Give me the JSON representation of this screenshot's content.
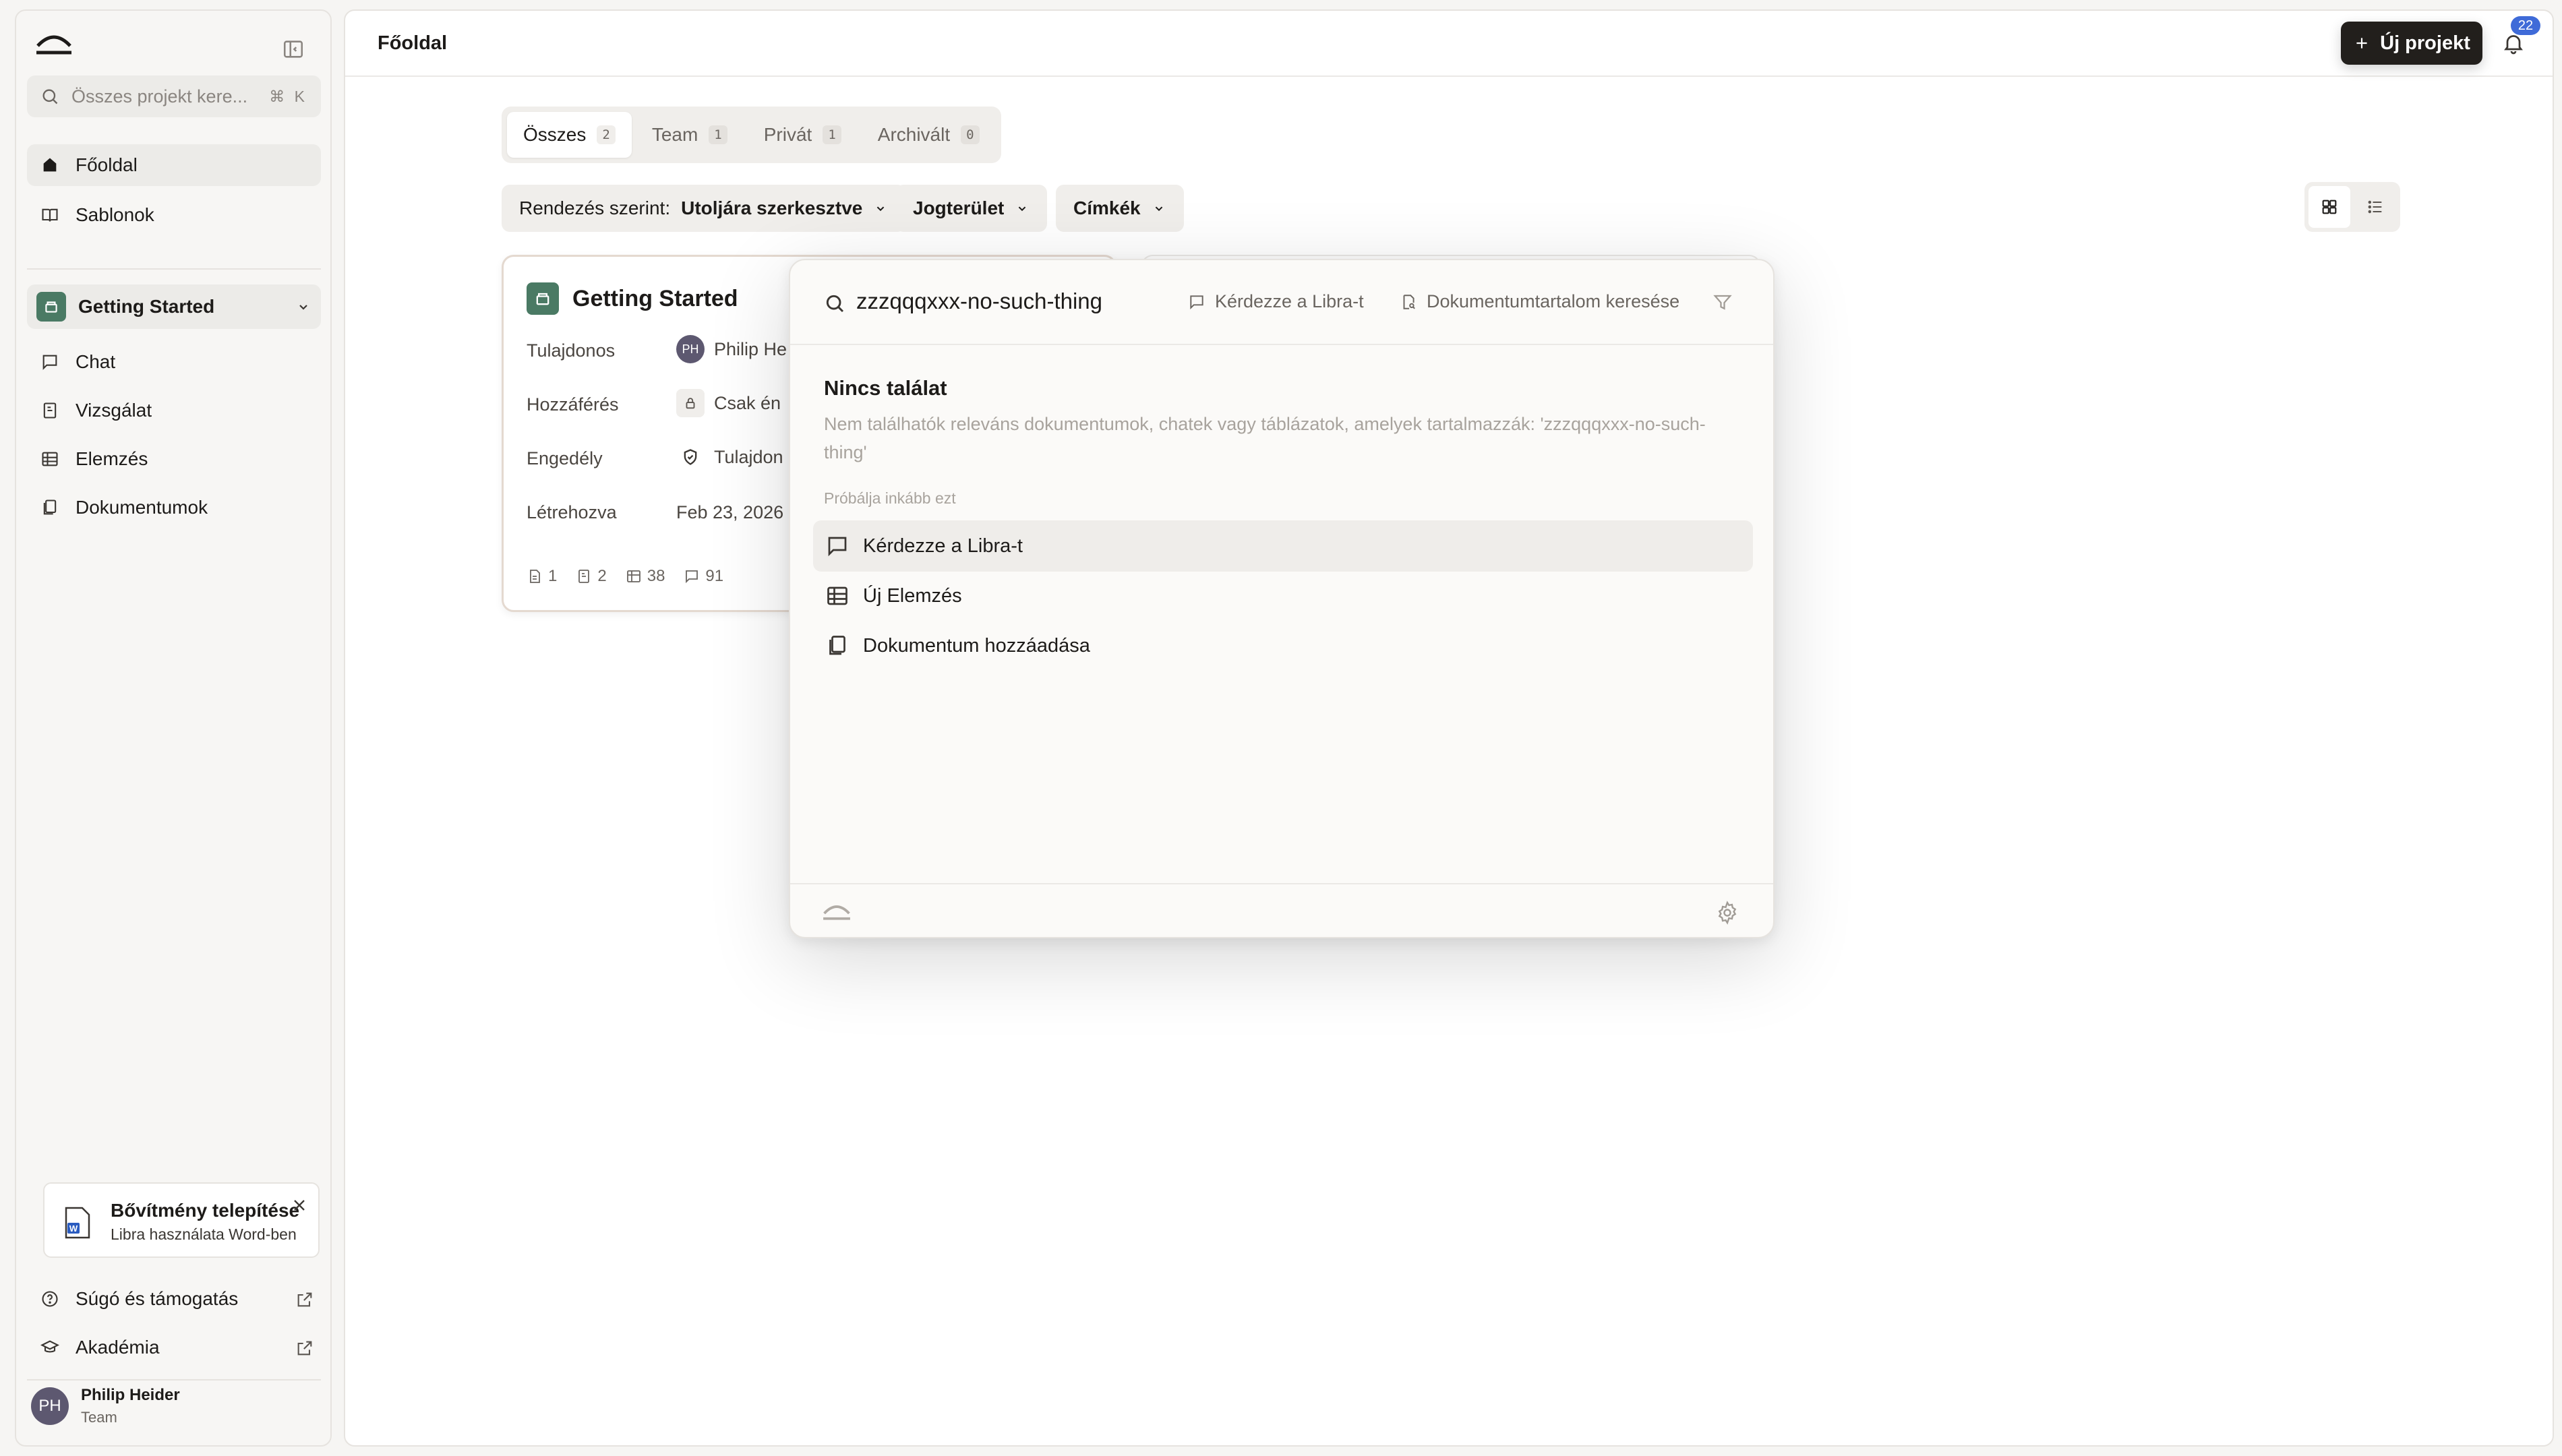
{
  "sidebar": {
    "search_placeholder": "Összes projekt kere...",
    "search_shortcut": "⌘ K",
    "nav": [
      {
        "label": "Főoldal"
      },
      {
        "label": "Sablonok"
      }
    ],
    "project_selector": "Getting Started",
    "project_nav": [
      {
        "label": "Chat"
      },
      {
        "label": "Vizsgálat"
      },
      {
        "label": "Elemzés"
      },
      {
        "label": "Dokumentumok"
      }
    ],
    "extension": {
      "title": "Bővítmény telepítése",
      "subtitle": "Libra használata Word-ben"
    },
    "footer_links": [
      {
        "label": "Súgó és támogatás"
      },
      {
        "label": "Akadémia"
      }
    ],
    "user": {
      "initials": "PH",
      "name": "Philip Heider",
      "team": "Team"
    }
  },
  "header": {
    "title": "Főoldal",
    "new_project_label": "Új projekt",
    "notification_count": "22"
  },
  "tabs": [
    {
      "label": "Összes",
      "count": "2",
      "active": true
    },
    {
      "label": "Team",
      "count": "1"
    },
    {
      "label": "Privát",
      "count": "1"
    },
    {
      "label": "Archivált",
      "count": "0"
    }
  ],
  "filters": {
    "sort_prefix": "Rendezés szerint:",
    "sort_value": "Utoljára szerkesztve",
    "jurisdiction": "Jogterület",
    "tags": "Címkék"
  },
  "project_card": {
    "title": "Getting Started",
    "owner_label": "Tulajdonos",
    "owner_initials": "PH",
    "owner_value": "Philip He",
    "access_label": "Hozzáférés",
    "access_value": "Csak én",
    "permission_label": "Engedély",
    "permission_value": "Tulajdon",
    "created_label": "Létrehozva",
    "created_value": "Feb 23, 2026",
    "stats": [
      "1",
      "2",
      "38",
      "91"
    ]
  },
  "search_modal": {
    "query": "zzzqqqxxx-no-such-thing",
    "ask_label": "Kérdezze a Libra-t",
    "doc_search_label": "Dokumentumtartalom keresése",
    "no_results_title": "Nincs találat",
    "no_results_desc": "Nem találhatók releváns dokumentumok, chatek vagy táblázatok, amelyek tartalmazzák: 'zzzqqqxxx-no-such-thing'",
    "try_instead": "Próbálja inkább ezt",
    "options": [
      {
        "label": "Kérdezze a Libra-t",
        "icon": "chat-icon"
      },
      {
        "label": "Új Elemzés",
        "icon": "table-icon"
      },
      {
        "label": "Dokumentum hozzáadása",
        "icon": "documents-icon"
      }
    ]
  }
}
